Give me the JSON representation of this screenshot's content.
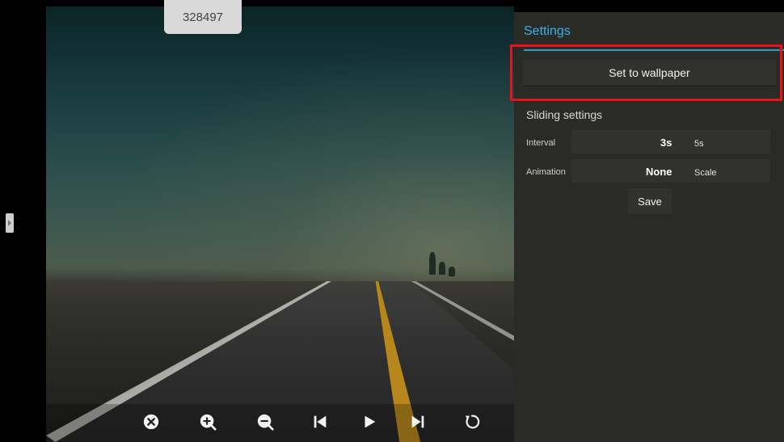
{
  "image_id_label": "328497",
  "settings": {
    "title": "Settings",
    "set_wallpaper_label": "Set to wallpaper",
    "sliding_settings_label": "Sliding settings",
    "interval": {
      "label": "Interval",
      "selected": "3s",
      "option": "5s"
    },
    "animation": {
      "label": "Animation",
      "selected": "None",
      "option": "Scale"
    },
    "save_label": "Save"
  },
  "controls": {
    "icons": [
      "close-circle-icon",
      "zoom-in-icon",
      "zoom-out-icon",
      "skip-previous-icon",
      "play-icon",
      "skip-next-icon",
      "rotate-icon"
    ]
  },
  "colors": {
    "accent": "#38b3ea",
    "highlight": "#e4141a"
  }
}
